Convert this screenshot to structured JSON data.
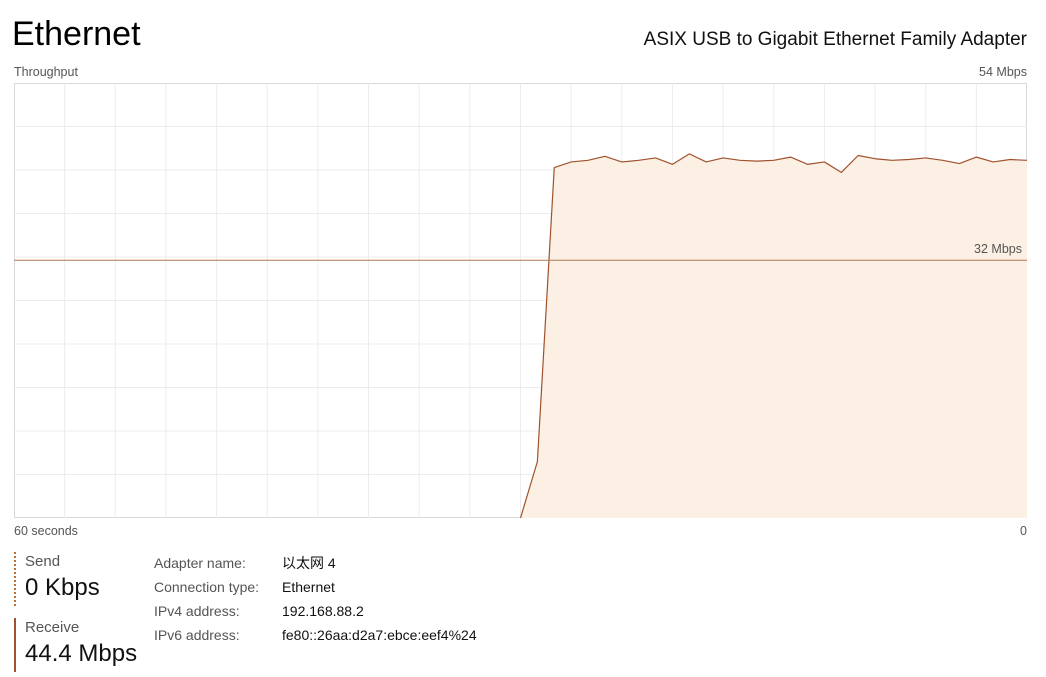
{
  "header": {
    "title": "Ethernet",
    "adapter": "ASIX USB to Gigabit Ethernet Family Adapter"
  },
  "chart_data": {
    "type": "area",
    "title": "Throughput",
    "xlabel": "60 seconds",
    "x_range_label_right": "0",
    "y_max_label": "54 Mbps",
    "reference_line_label": "32 Mbps",
    "ylim": [
      0,
      54
    ],
    "xlim": [
      60,
      0
    ],
    "grid": true,
    "reference_line": 32,
    "x": [
      30,
      29,
      28,
      27,
      26,
      25,
      24,
      23,
      22,
      21,
      20,
      19,
      18,
      17,
      16,
      15,
      14,
      13,
      12,
      11,
      10,
      9,
      8,
      7,
      6,
      5,
      4,
      3,
      2,
      1,
      0
    ],
    "values": [
      0,
      7,
      43.5,
      44.2,
      44.4,
      44.9,
      44.2,
      44.4,
      44.7,
      43.9,
      45.2,
      44.2,
      44.7,
      44.4,
      44.3,
      44.4,
      44.8,
      43.9,
      44.2,
      42.9,
      45,
      44.6,
      44.4,
      44.5,
      44.7,
      44.4,
      44,
      44.8,
      44.2,
      44.5,
      44.4
    ],
    "colors": {
      "line": "#a0522d",
      "fill": "#fcefe3",
      "grid": "#ececec",
      "reference": "#b07a55"
    }
  },
  "stats": {
    "send": {
      "label": "Send",
      "value": "0 Kbps"
    },
    "receive": {
      "label": "Receive",
      "value": "44.4 Mbps"
    }
  },
  "info": [
    {
      "key": "Adapter name:",
      "value": "以太网 4"
    },
    {
      "key": "Connection type:",
      "value": "Ethernet"
    },
    {
      "key": "IPv4 address:",
      "value": "192.168.88.2"
    },
    {
      "key": "IPv6 address:",
      "value": "fe80::26aa:d2a7:ebce:eef4%24"
    }
  ]
}
